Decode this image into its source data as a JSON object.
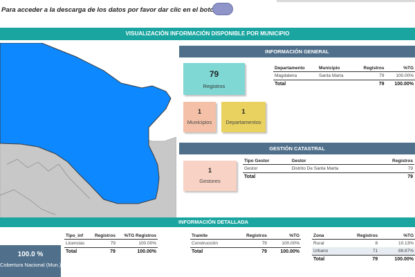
{
  "top": {
    "hint": "Para acceder a la descarga de los datos por favor dar clic en el botón"
  },
  "banner": {
    "title": "VISUALIZACIÓN INFORMACIÓN DISPONIBLE POR MUNICIPIO"
  },
  "colors": {
    "teal": "#1aa5a0",
    "slate": "#4f6f8b",
    "map_fill": "#0d88ff",
    "map_gray": "#c8c8c8"
  },
  "general": {
    "title": "INFORMACIÓN GENERAL",
    "registros_card": {
      "value": "79",
      "label": "Registros"
    },
    "municipios_card": {
      "value": "1",
      "label": "Municipios"
    },
    "departamentos_card": {
      "value": "1",
      "label": "Departamentos"
    },
    "table": {
      "headers": [
        "Departamento",
        "Municipio",
        "Registros",
        "%TG"
      ],
      "rows": [
        [
          "Magdalena",
          "Santa Marta",
          "79",
          "100.00%"
        ]
      ],
      "total": [
        "Total",
        "",
        "79",
        "100.00%"
      ]
    }
  },
  "catastral": {
    "title": "GESTIÓN CATASTRAL",
    "gestores_card": {
      "value": "1",
      "label": "Gestores"
    },
    "table": {
      "headers": [
        "Tipo Gestor",
        "Gestor",
        "Registros"
      ],
      "rows": [
        [
          "Gestor",
          "Distrito De Santa Marta",
          "79"
        ]
      ],
      "total": [
        "Total",
        "",
        "79"
      ]
    }
  },
  "detallada": {
    "title": "INFORMACIÓN DETALLADA"
  },
  "cobertura": {
    "value": "100.0 %",
    "label": "Cobertura Nacional (Mun.)"
  },
  "tipo_inf": {
    "headers": [
      "Tipo_inf",
      "Registros",
      "%TG Registros"
    ],
    "rows": [
      [
        "Licencias",
        "79",
        "100.00%"
      ]
    ],
    "total": [
      "Total",
      "79",
      "100.00%"
    ]
  },
  "tramite": {
    "headers": [
      "Tramite",
      "Registros",
      "%TG"
    ],
    "rows": [
      [
        "Construcción",
        "79",
        "100.00%"
      ]
    ],
    "total": [
      "Total",
      "79",
      "100.00%"
    ]
  },
  "zona": {
    "headers": [
      "Zona",
      "Registros",
      "%TG"
    ],
    "rows": [
      [
        "Rural",
        "8",
        "10.13%"
      ],
      [
        "Urbano",
        "71",
        "89.87%"
      ]
    ],
    "total": [
      "Total",
      "79",
      "100.00%"
    ]
  }
}
